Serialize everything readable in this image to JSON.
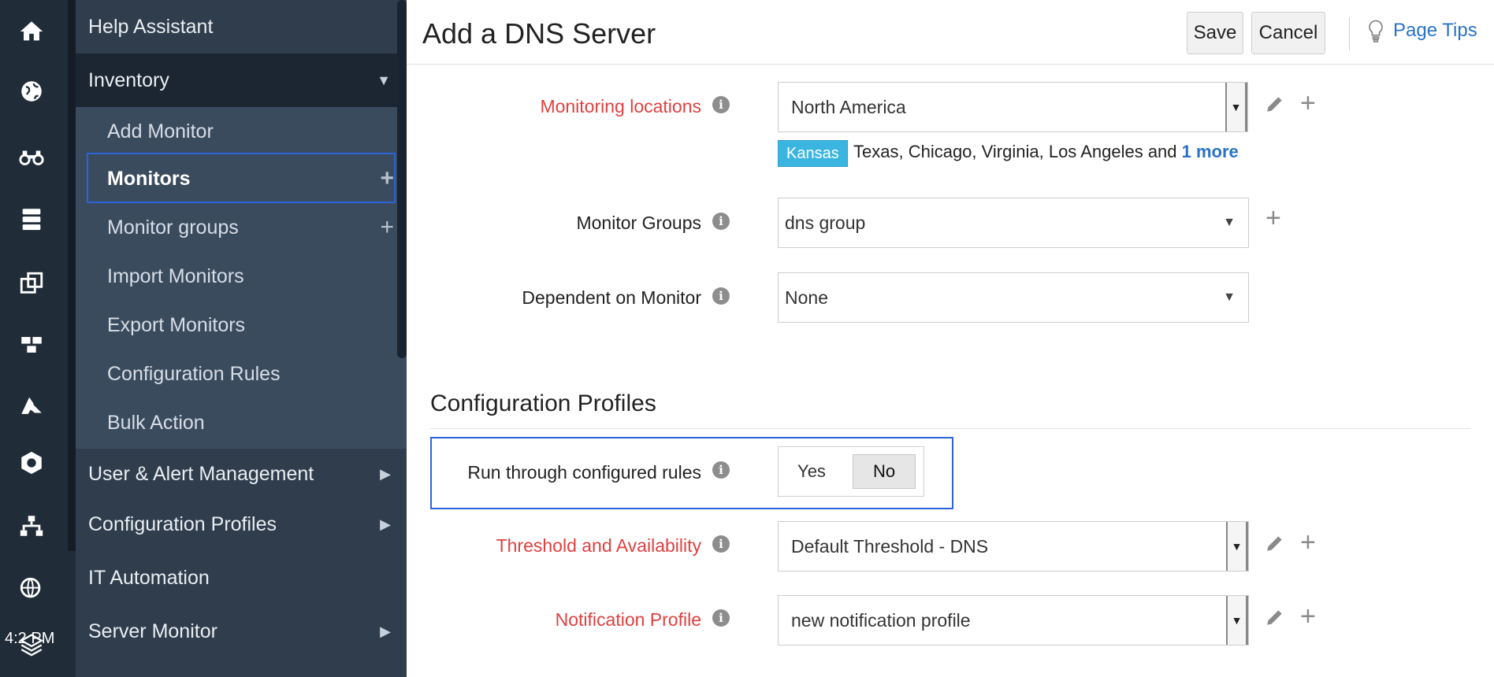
{
  "rail": {
    "icons": [
      "home-icon",
      "globe-icon",
      "binoculars-icon",
      "server-stack-icon",
      "copy-icon",
      "aws-cubes-icon",
      "azure-icon",
      "gcp-hexagon-icon",
      "network-topology-icon",
      "web-search-icon",
      "layers-icon"
    ],
    "time": "4:2 PM"
  },
  "nav": {
    "help": "Help Assistant",
    "inventory": "Inventory",
    "items": [
      "Add Monitor",
      "Monitors",
      "Monitor groups",
      "Import Monitors",
      "Export Monitors",
      "Configuration Rules",
      "Bulk Action"
    ],
    "sections": [
      "User & Alert Management",
      "Configuration Profiles",
      "IT Automation",
      "Server Monitor"
    ]
  },
  "header": {
    "title": "Add a DNS Server",
    "save": "Save",
    "cancel": "Cancel",
    "tips": "Page Tips"
  },
  "form": {
    "monitoring_locations": {
      "label": "Monitoring locations",
      "value": "North America"
    },
    "locations_tag": "Kansas",
    "locations_list": "Texas, Chicago, Virginia, Los Angeles and ",
    "locations_more": "1 more",
    "monitor_groups": {
      "label": "Monitor Groups",
      "value": "dns group"
    },
    "dependent": {
      "label": "Dependent on Monitor",
      "value": "None"
    },
    "section_title": "Configuration Profiles",
    "run_rules": {
      "label": "Run through configured rules",
      "yes": "Yes",
      "no": "No",
      "selected": "No"
    },
    "threshold": {
      "label": "Threshold and Availability",
      "value": "Default Threshold - DNS"
    },
    "notification": {
      "label": "Notification Profile",
      "value": "new notification profile"
    }
  },
  "colors": {
    "accent": "#2a73c6",
    "required": "#e04040",
    "focus": "#2b63d9",
    "tag": "#3ab5e0"
  }
}
